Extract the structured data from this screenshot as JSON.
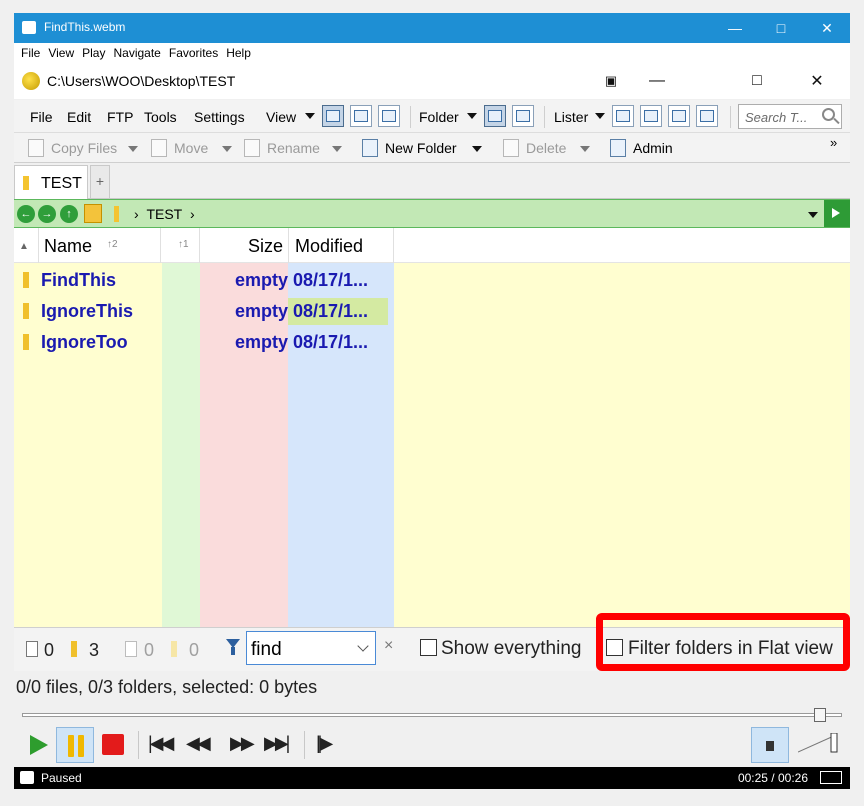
{
  "player": {
    "title": "FindThis.webm",
    "menu": [
      "File",
      "View",
      "Play",
      "Navigate",
      "Favorites",
      "Help"
    ],
    "seek_fraction": 0.98,
    "status": "Paused",
    "time": "00:25 / 00:26"
  },
  "dopus": {
    "path": "C:\\Users\\WOO\\Desktop\\TEST",
    "menu": {
      "file": "File",
      "edit": "Edit",
      "ftp": "FTP",
      "tools": "Tools",
      "settings": "Settings",
      "view": "View",
      "folder": "Folder",
      "lister": "Lister"
    },
    "search_placeholder": "Search T...",
    "toolbar": {
      "copy": "Copy Files",
      "move": "Move",
      "rename": "Rename",
      "new_folder": "New Folder",
      "delete": "Delete",
      "admin": "Admin"
    },
    "tab": "TEST",
    "breadcrumb": "TEST",
    "columns": {
      "name": "Name",
      "name_sort": "2",
      "sort2": "1",
      "size": "Size",
      "modified": "Modified"
    },
    "rows": [
      {
        "name": "FindThis",
        "size": "empty",
        "modified": "08/17/1..."
      },
      {
        "name": "IgnoreThis",
        "size": "empty",
        "modified": "08/17/1..."
      },
      {
        "name": "IgnoreToo",
        "size": "empty",
        "modified": "08/17/1..."
      }
    ],
    "filter": {
      "files_count": "0",
      "folders_count": "3",
      "hidden_files": "0",
      "hidden_folders": "0",
      "value": "find",
      "clear": "×",
      "show_everything": "Show everything",
      "flat_view": "Filter folders in Flat view"
    },
    "status": "0/0 files, 0/3 folders, selected: 0 bytes"
  },
  "colors": {
    "accent": "#1e8fd4",
    "highlight": "#ff0000",
    "path_bar": "#c2e8b5"
  }
}
